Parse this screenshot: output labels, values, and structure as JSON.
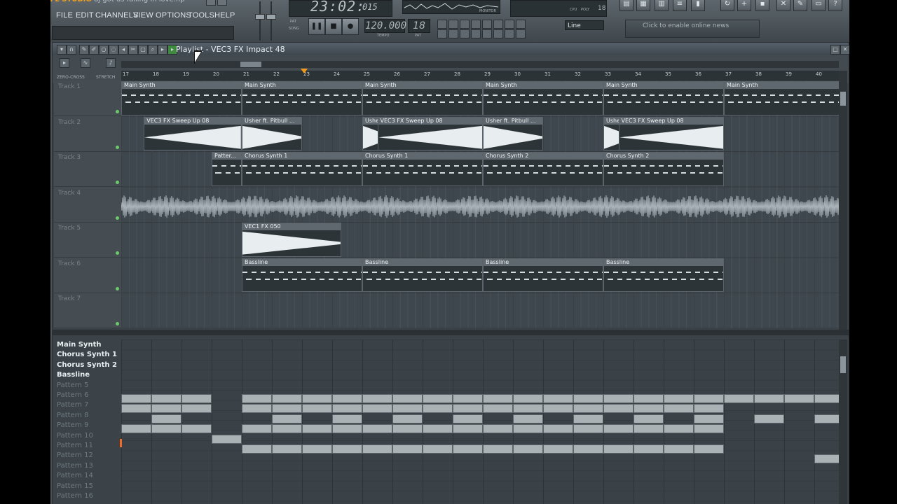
{
  "app": {
    "logo": "FL STUDIO",
    "title": "dj got us falling in love.flp",
    "menu": [
      "FILE",
      "EDIT",
      "CHANNELS",
      "VIEW",
      "OPTIONS",
      "TOOLS",
      "HELP"
    ]
  },
  "transport": {
    "time": "23:02:",
    "time_small": "015",
    "tempo": "120.000",
    "tempo_label": "TEMPO",
    "pattern": "18",
    "pattern_label": "PAT",
    "pat_song": [
      "PAT",
      "SONG"
    ],
    "monitor_label": "MONITOR",
    "snap": "Line",
    "news": "Click to enable online news",
    "cpu_label": "CPU",
    "poly_label": "POLY",
    "poly_value": "18"
  },
  "playlist": {
    "title": "Playlist - VEC3 FX Impact 48",
    "zero_cross": "ZERO-CROSS",
    "stretch": "STRETCH",
    "bars": [
      "17",
      "18",
      "19",
      "20",
      "21",
      "22",
      "23",
      "24",
      "25",
      "26",
      "27",
      "28",
      "29",
      "30",
      "31",
      "32",
      "33",
      "34",
      "35",
      "36",
      "37",
      "38",
      "39",
      "40"
    ],
    "tracks": [
      "Track 1",
      "Track 2",
      "Track 3",
      "Track 4",
      "Track 5",
      "Track 6",
      "Track 7"
    ],
    "clips": [
      {
        "label": "Main Synth",
        "track": 0,
        "start": 0,
        "len": 4,
        "kind": "notes"
      },
      {
        "label": "Main Synth",
        "track": 0,
        "start": 4,
        "len": 4,
        "kind": "notes"
      },
      {
        "label": "Main Synth",
        "track": 0,
        "start": 8,
        "len": 4,
        "kind": "notes"
      },
      {
        "label": "Main Synth",
        "track": 0,
        "start": 12,
        "len": 4,
        "kind": "notes"
      },
      {
        "label": "Main Synth",
        "track": 0,
        "start": 16,
        "len": 4,
        "kind": "notes"
      },
      {
        "label": "Main Synth",
        "track": 0,
        "start": 20,
        "len": 4,
        "kind": "notes"
      },
      {
        "label": "VEC3 FX Sweep Up 08",
        "track": 1,
        "start": 0.75,
        "len": 3.25,
        "kind": "sweep"
      },
      {
        "label": "Usher ft. Pitbull ...",
        "track": 1,
        "start": 4,
        "len": 2,
        "kind": "hit"
      },
      {
        "label": "Usher",
        "track": 1,
        "start": 8,
        "len": 1,
        "kind": "hit"
      },
      {
        "label": "VEC3 FX Sweep Up 08",
        "track": 1,
        "start": 8.5,
        "len": 3.5,
        "kind": "sweep"
      },
      {
        "label": "Usher ft. Pitbull ...",
        "track": 1,
        "start": 12,
        "len": 2,
        "kind": "hit"
      },
      {
        "label": "Usher",
        "track": 1,
        "start": 16,
        "len": 1,
        "kind": "hit"
      },
      {
        "label": "VEC3 FX Sweep Up 08",
        "track": 1,
        "start": 16.5,
        "len": 3.5,
        "kind": "sweep"
      },
      {
        "label": "Patter...",
        "track": 2,
        "start": 3,
        "len": 1,
        "kind": "notes"
      },
      {
        "label": "Chorus Synth 1",
        "track": 2,
        "start": 4,
        "len": 4,
        "kind": "notes"
      },
      {
        "label": "Chorus Synth 1",
        "track": 2,
        "start": 8,
        "len": 4,
        "kind": "notes"
      },
      {
        "label": "Chorus Synth 2",
        "track": 2,
        "start": 12,
        "len": 4,
        "kind": "notes"
      },
      {
        "label": "Chorus Synth 2",
        "track": 2,
        "start": 16,
        "len": 4,
        "kind": "notes"
      },
      {
        "label": "VEC1 FX 050",
        "track": 4,
        "start": 4,
        "len": 3.3,
        "kind": "hit"
      },
      {
        "label": "Bassline",
        "track": 5,
        "start": 4,
        "len": 4,
        "kind": "notes"
      },
      {
        "label": "Bassline",
        "track": 5,
        "start": 8,
        "len": 4,
        "kind": "notes"
      },
      {
        "label": "Bassline",
        "track": 5,
        "start": 12,
        "len": 4,
        "kind": "notes"
      },
      {
        "label": "Bassline",
        "track": 5,
        "start": 16,
        "len": 4,
        "kind": "notes"
      }
    ]
  },
  "picker": {
    "patterns": [
      {
        "name": "Main Synth",
        "on": true
      },
      {
        "name": "Chorus Synth 1",
        "on": true
      },
      {
        "name": "Chorus Synth 2",
        "on": true
      },
      {
        "name": "Bassline",
        "on": true
      },
      {
        "name": "Pattern 5",
        "on": false
      },
      {
        "name": "Pattern 6",
        "on": false
      },
      {
        "name": "Pattern 7",
        "on": false
      },
      {
        "name": "Pattern 8",
        "on": false
      },
      {
        "name": "Pattern 9",
        "on": false
      },
      {
        "name": "Pattern 10",
        "on": false
      },
      {
        "name": "Pattern 11",
        "on": false
      },
      {
        "name": "Pattern 12",
        "on": false
      },
      {
        "name": "Pattern 13",
        "on": false
      },
      {
        "name": "Pattern 14",
        "on": false
      },
      {
        "name": "Pattern 15",
        "on": false
      },
      {
        "name": "Pattern 16",
        "on": false
      }
    ],
    "blocks": [
      {
        "row": 5,
        "bars": [
          0,
          1,
          2,
          4,
          5,
          6,
          7,
          8,
          9,
          10,
          11,
          12,
          13,
          14,
          15,
          16,
          17,
          18,
          19,
          20,
          21,
          22,
          23
        ]
      },
      {
        "row": 6,
        "bars": [
          0,
          1,
          2,
          4,
          5,
          6,
          7,
          8,
          9,
          10,
          11,
          12,
          13,
          14,
          15,
          16,
          17,
          18,
          19
        ]
      },
      {
        "row": 7,
        "bars": [
          1,
          5,
          7,
          9,
          11,
          13,
          15,
          17,
          19,
          21,
          23
        ]
      },
      {
        "row": 8,
        "bars": [
          0,
          1,
          2,
          4,
          5,
          6,
          7,
          8,
          9,
          10,
          11,
          12,
          13,
          14,
          15,
          16,
          17,
          18,
          19
        ]
      },
      {
        "row": 9,
        "bars": [
          3
        ]
      },
      {
        "row": 10,
        "bars": [
          4,
          5,
          6,
          7,
          8,
          9,
          10,
          11,
          12,
          13,
          14,
          15,
          16,
          17,
          18,
          19
        ]
      },
      {
        "row": 11,
        "bars": [
          23
        ]
      }
    ]
  }
}
